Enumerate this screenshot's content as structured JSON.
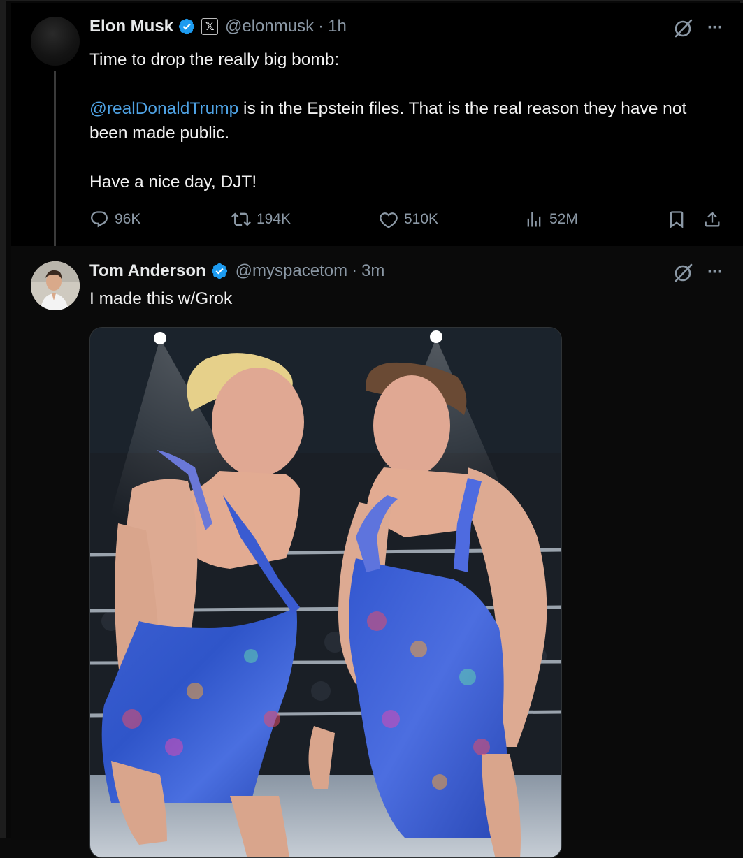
{
  "tweet1": {
    "name": "Elon Musk",
    "handle": "@elonmusk",
    "separator": "·",
    "time": "1h",
    "x_badge": "𝕏",
    "line1": "Time to drop the really big bomb:",
    "mention": "@realDonaldTrump",
    "line2": " is in the Epstein files. That is the real reason they have not been made public.",
    "line3": "Have a nice day, DJT!",
    "more": "···",
    "stats": {
      "replies": "96K",
      "reposts": "194K",
      "likes": "510K",
      "views": "52M"
    }
  },
  "tweet2": {
    "name": "Tom Anderson",
    "handle": "@myspacetom",
    "separator": "·",
    "time": "3m",
    "text": "I made this w/Grok",
    "more": "···"
  },
  "icons": {
    "verified": "verified-badge-icon",
    "grok": "grok-icon",
    "reply": "reply-icon",
    "repost": "repost-icon",
    "like": "heart-icon",
    "views": "views-icon",
    "bookmark": "bookmark-icon",
    "share": "share-icon"
  },
  "colors": {
    "background": "#000000",
    "text": "#e7e9ea",
    "secondary": "#8b98a5",
    "link": "#4fa3e5",
    "verified": "#1d9bf0"
  }
}
